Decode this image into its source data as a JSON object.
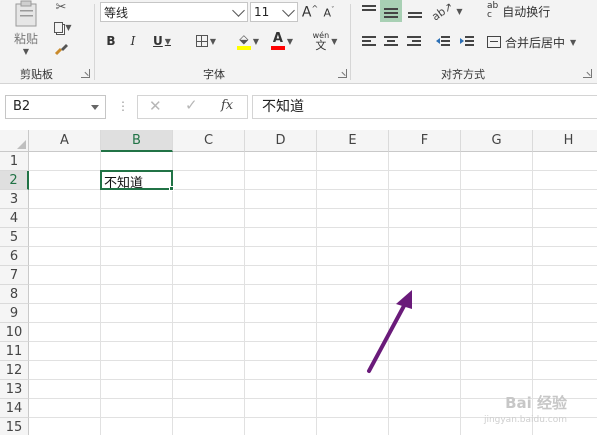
{
  "ribbon": {
    "clipboard": {
      "paste_label": "粘贴",
      "group_label": "剪贴板"
    },
    "font": {
      "font_name": "等线",
      "font_size": "11",
      "bold": "B",
      "italic": "I",
      "underline": "U",
      "phonetic_top": "wén",
      "phonetic_bottom": "文",
      "group_label": "字体",
      "highlight_color": "#ffff00",
      "font_color": "#ff0000"
    },
    "alignment": {
      "wrap_text": "自动换行",
      "merge_center": "合并后居中",
      "wrap_icon_top": "ab",
      "wrap_icon_bottom": "c",
      "group_label": "对齐方式",
      "active_color": "#a8d0b4"
    }
  },
  "formula_bar": {
    "name_box": "B2",
    "fx": "fx",
    "content": "不知道"
  },
  "sheet": {
    "columns": [
      "A",
      "B",
      "C",
      "D",
      "E",
      "F",
      "G",
      "H"
    ],
    "rows": [
      "1",
      "2",
      "3",
      "4",
      "5",
      "6",
      "7",
      "8",
      "9",
      "10",
      "11",
      "12",
      "13",
      "14",
      "15"
    ],
    "active_cell": "B2",
    "active_column": "B",
    "active_row": "2",
    "cells": [
      {
        "ref": "B2",
        "value": "不知道"
      }
    ],
    "accent_color": "#217346"
  },
  "annotation": {
    "arrow_color": "#6a1b7a"
  },
  "watermark": {
    "text": "Bai 经验",
    "sub": "jingyan.baidu.com"
  }
}
